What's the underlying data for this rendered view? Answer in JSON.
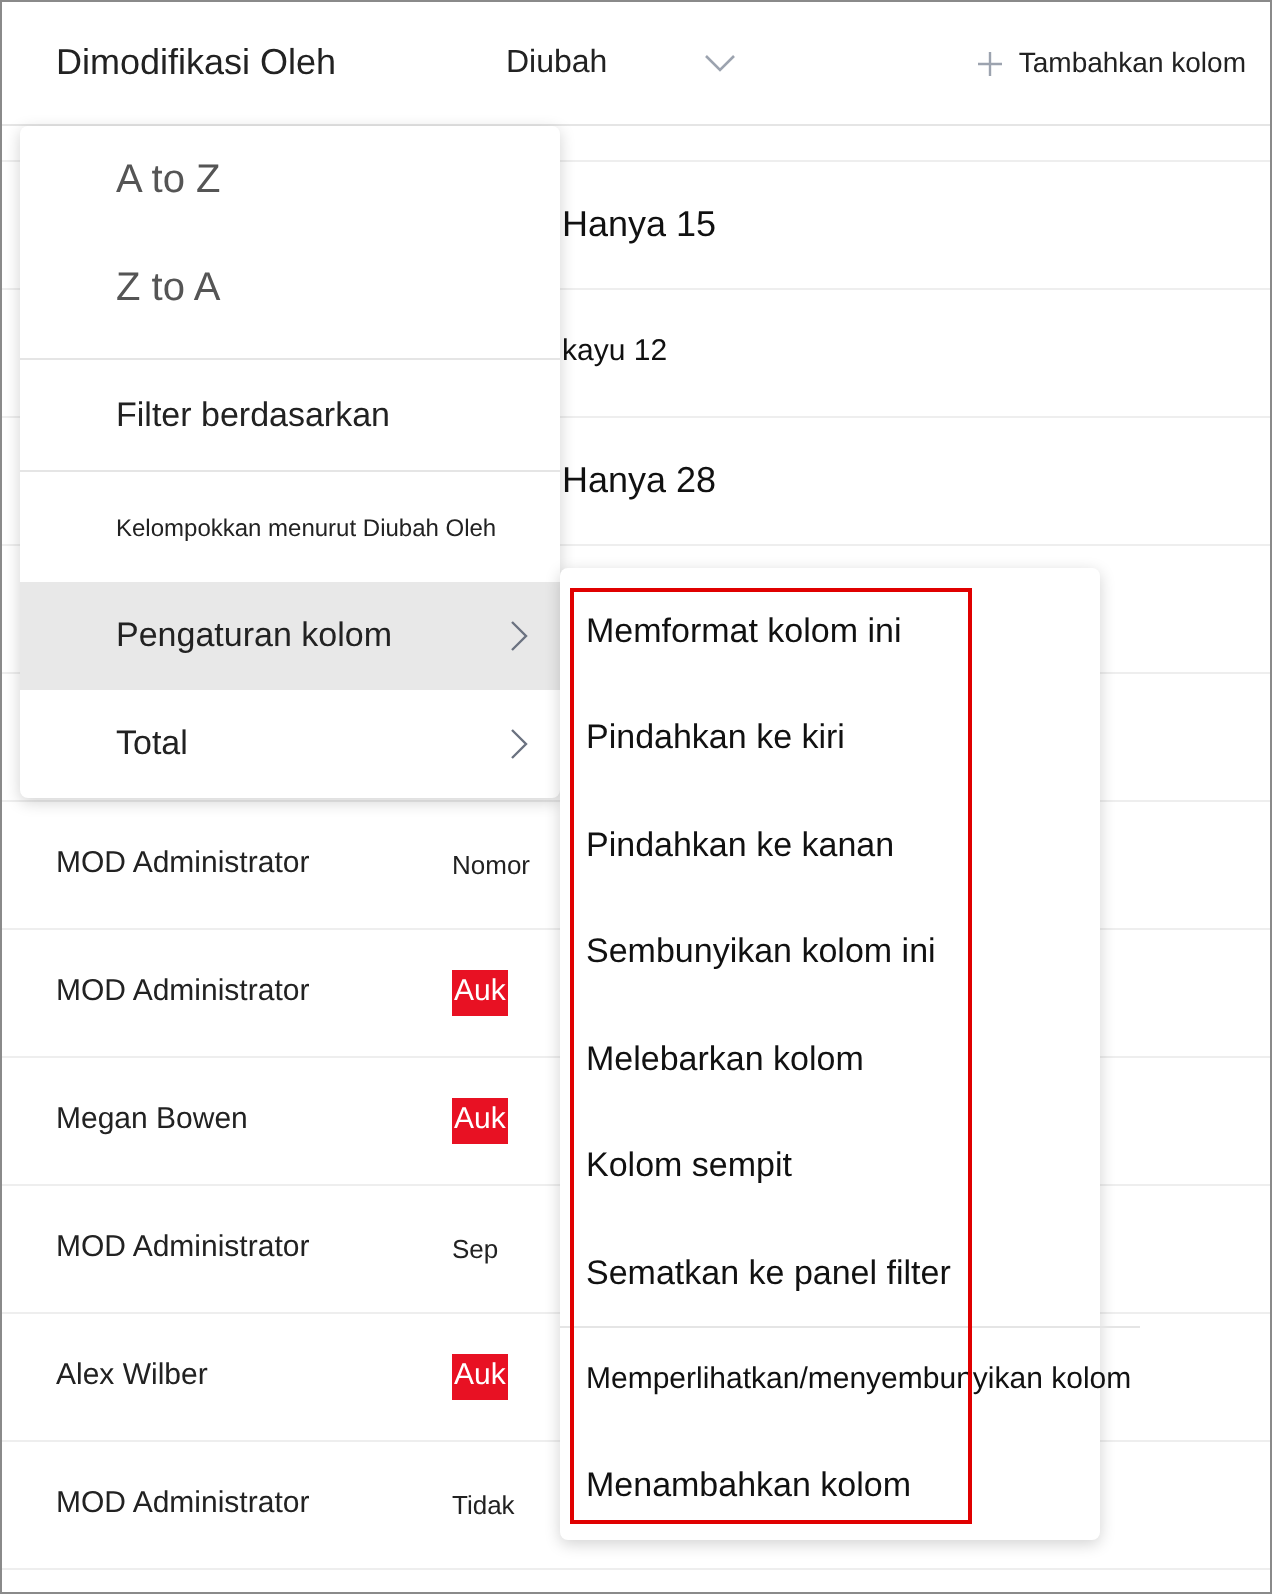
{
  "header": {
    "columns": [
      {
        "label": "Dimodifikasi Oleh",
        "sortable": false
      },
      {
        "label": "Diubah",
        "sortable": true
      }
    ],
    "add_column": "Tambahkan kolom"
  },
  "rows": [
    {
      "kind": "spacer"
    },
    {
      "kind": "covered",
      "column_2": "Hanya 15",
      "flagged": false
    },
    {
      "kind": "covered",
      "column_2": "kayu 12",
      "flagged": false
    },
    {
      "kind": "covered",
      "column_2": "Hanya 28",
      "flagged": false
    },
    {
      "kind": "spacer"
    },
    {
      "kind": "spacer"
    },
    {
      "kind": "plain",
      "column_1": "MOD Administrator",
      "column_2": "Nomor",
      "flagged": false
    },
    {
      "kind": "plain",
      "column_1": "MOD Administrator",
      "column_2": "Auk",
      "flagged": true
    },
    {
      "kind": "plain",
      "column_1": "Megan Bowen",
      "column_2": "Auk",
      "flagged": true
    },
    {
      "kind": "plain",
      "column_1": "MOD Administrator",
      "column_2": "Sep",
      "flagged": false
    },
    {
      "kind": "plain",
      "column_1": "Alex Wilber",
      "column_2": "Auk",
      "flagged": true
    },
    {
      "kind": "plain",
      "column_1": "MOD Administrator",
      "column_2": "Tidak",
      "flagged": false
    }
  ],
  "column_menu": [
    {
      "kind": "sort",
      "label": "A to Z",
      "selected": false,
      "submenu": false
    },
    {
      "kind": "sort",
      "label": "Z to A",
      "selected": false,
      "submenu": false
    },
    {
      "kind": "filter",
      "label": "Filter berdasarkan",
      "selected": false,
      "submenu": false
    },
    {
      "kind": "group",
      "label": "Kelompokkan menurut Diubah Oleh",
      "selected": false,
      "submenu": false
    },
    {
      "kind": "setting",
      "label": "Pengaturan kolom",
      "selected": true,
      "submenu": true
    },
    {
      "kind": "setting",
      "label": "Total",
      "selected": false,
      "submenu": true
    }
  ],
  "settings_submenu": [
    {
      "label": "Memformat kolom ini",
      "divider_before": false
    },
    {
      "label": "Pindahkan ke kiri",
      "divider_before": false
    },
    {
      "label": "Pindahkan ke kanan",
      "divider_before": false
    },
    {
      "label": "Sembunyikan kolom ini",
      "divider_before": false
    },
    {
      "label": "Melebarkan kolom",
      "divider_before": false
    },
    {
      "label": "Kolom sempit",
      "divider_before": false
    },
    {
      "label": "Sematkan ke panel filter",
      "divider_before": false
    },
    {
      "label": "Memperlihatkan/menyembunyikan kolom",
      "divider_before": true
    },
    {
      "label": "Menambahkan kolom",
      "divider_before": false
    }
  ],
  "annotation": {
    "highlight_box": true
  }
}
